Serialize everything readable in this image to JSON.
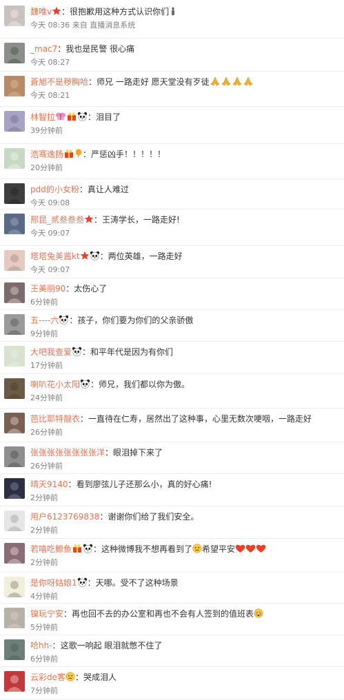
{
  "colors": {
    "username": "#eb7350",
    "text": "#333333",
    "meta": "#808080",
    "divider": "#ececec",
    "background": "#ffffff"
  },
  "comments": [
    {
      "user": "魏唯v",
      "badges": [
        "star"
      ],
      "sep": "：",
      "text": "很抱歉用这种方式认识你们",
      "trail": [
        "candle"
      ],
      "time": "今天 08:36",
      "source": "来自 直播消息系统",
      "avatar": "#c9c2bf"
    },
    {
      "user": "_mac7",
      "badges": [],
      "sep": "：",
      "text": "我也是民警 很心痛",
      "trail": [],
      "time": "今天 08:27",
      "source": "",
      "avatar": "#8a8f8a"
    },
    {
      "user": "蒼旭不是秽胸哈",
      "badges": [],
      "sep": "：",
      "text": "师兄 一路走好 愿天堂没有歹徒",
      "trail": [
        "pray",
        "pray",
        "pray",
        "pray"
      ],
      "time": "今天 08:21",
      "source": "",
      "avatar": "#b98a66"
    },
    {
      "user": "林智拉",
      "badges": [
        "butterfly",
        "gift",
        "panda"
      ],
      "sep": "：",
      "text": "泪目了",
      "trail": [],
      "time": "39分钟前",
      "source": "",
      "avatar": "#a7a3c6"
    },
    {
      "user": "浩骞逸扬",
      "badges": [
        "gift",
        "balloon"
      ],
      "sep": "：",
      "text": "严惩凶手！！！！！",
      "trail": [],
      "time": "20分钟前",
      "source": "",
      "avatar": "#c7d9c4"
    },
    {
      "user": "pdd的小女粉",
      "badges": [],
      "sep": "：",
      "text": "真让人难过",
      "trail": [],
      "time": "今天 09:08",
      "source": "",
      "avatar": "#3e3e3e"
    },
    {
      "user": "邢昆_贰叁叁叁",
      "badges": [
        "star"
      ],
      "sep": "：",
      "text": "王涛学长，一路走好!",
      "trail": [],
      "time": "今天 09:07",
      "source": "",
      "avatar": "#5a6a86"
    },
    {
      "user": "塔塔兔美酱kt",
      "badges": [
        "star",
        "panda"
      ],
      "sep": "：",
      "text": "两位英雄，一路走好",
      "trail": [],
      "time": "今天 09:07",
      "source": "",
      "avatar": "#e7c9c2"
    },
    {
      "user": "王美丽90",
      "badges": [],
      "sep": "：",
      "text": "太伤心了",
      "trail": [],
      "time": "6分钟前",
      "source": "",
      "avatar": "#7d6a6a"
    },
    {
      "user": "五----六",
      "badges": [
        "panda"
      ],
      "sep": "：",
      "text": "孩子，你们要为你们的父亲骄傲",
      "trail": [],
      "time": "9分钟前",
      "source": "",
      "avatar": "#9a9a9a"
    },
    {
      "user": "大吧我查爱",
      "badges": [
        "panda"
      ],
      "sep": "：",
      "text": "和平年代是因为有你们",
      "trail": [],
      "time": "17分钟前",
      "source": "",
      "avatar": "#d9e1d0"
    },
    {
      "user": "喇叭花小太阳",
      "badges": [
        "panda"
      ],
      "sep": "：",
      "text": "师兄，我们都以你为傲。",
      "trail": [],
      "time": "24分钟前",
      "source": "",
      "avatar": "#6b5a44"
    },
    {
      "user": "芭比耶特靓衣",
      "badges": [],
      "sep": "：",
      "text": "一直待在仁寿，居然出了这种事，心里无数次哽咽，一路走好",
      "trail": [],
      "time": "26分钟前",
      "source": "",
      "avatar": "#7a5f52"
    },
    {
      "user": "张张张张张张张张洋",
      "badges": [],
      "sep": "：",
      "text": "眼泪掉下来了",
      "trail": [],
      "time": "26分钟前",
      "source": "",
      "avatar": "#8e8e8e"
    },
    {
      "user": "晴天9140",
      "badges": [],
      "sep": "：",
      "text": "看到廖弦儿子还那么小，真的好心痛!",
      "trail": [],
      "time": "2分钟前",
      "source": "",
      "avatar": "#2c2f44"
    },
    {
      "user": "用户6123769838",
      "badges": [],
      "sep": "：",
      "text": "谢谢你们给了我们安全。",
      "trail": [],
      "time": "2分钟前",
      "source": "",
      "avatar": "#e6e6e6"
    },
    {
      "user": "若嘻吃鲸鱼",
      "badges": [
        "gift",
        "panda"
      ],
      "sep": "：",
      "text": "这种微博我不想再看到了",
      "trail": [
        "sad",
        "text:希望平安",
        "heart",
        "heart",
        "heart"
      ],
      "time": "2分钟前",
      "source": "",
      "avatar": "#8c6c74"
    },
    {
      "user": "是你呀姑娘1",
      "badges": [
        "panda"
      ],
      "sep": "：",
      "text": "天哪。受不了这种场景",
      "trail": [],
      "time": "4分钟前",
      "source": "",
      "avatar": "#f2eedc"
    },
    {
      "user": "镍玩宁安",
      "badges": [],
      "sep": "：",
      "text": "再也回不去的办公室和再也不会有人签到的值班表",
      "trail": [
        "cry"
      ],
      "time": "5分钟前",
      "source": "",
      "avatar": "#b8b1a8"
    },
    {
      "user": "哈hh-",
      "badges": [],
      "sep": "：",
      "text": "这歌一响起 眼泪就憋不住了",
      "trail": [],
      "time": "6分钟前",
      "source": "",
      "avatar": "#6e7f7a"
    },
    {
      "user": "云彩de客",
      "badges": [
        "sad"
      ],
      "sep": "：",
      "text": "哭成泪人",
      "trail": [],
      "time": "7分钟前",
      "source": "",
      "avatar": "#c0393b"
    }
  ]
}
